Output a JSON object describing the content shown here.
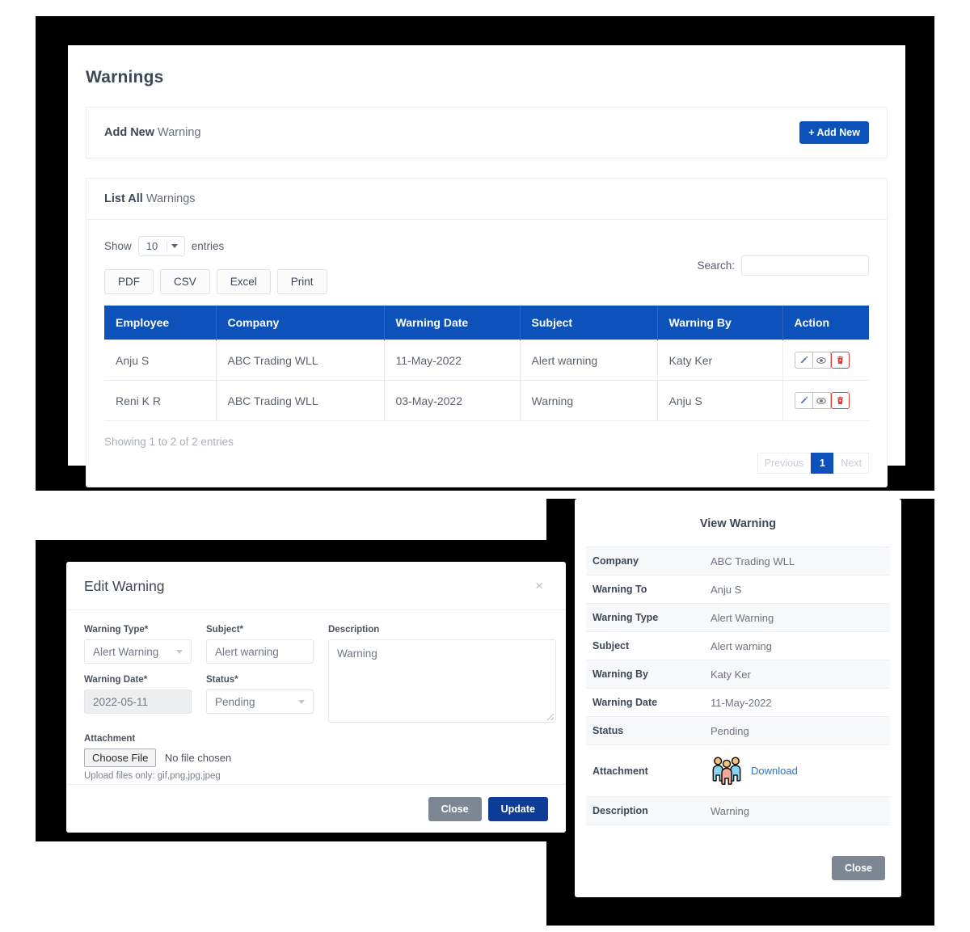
{
  "page": {
    "title": "Warnings",
    "add_card": {
      "label_strong": "Add New",
      "label_rest": " Warning",
      "button": "+ Add New"
    },
    "list_card": {
      "label_strong": "List All",
      "label_rest": " Warnings"
    }
  },
  "datatable": {
    "show_label": "Show",
    "length_value": "10",
    "entries_label": "entries",
    "export_buttons": [
      "PDF",
      "CSV",
      "Excel",
      "Print"
    ],
    "search_label": "Search:",
    "search_value": "",
    "search_placeholder": "",
    "columns": [
      "Employee",
      "Company",
      "Warning Date",
      "Subject",
      "Warning By",
      "Action"
    ],
    "rows": [
      {
        "employee": "Anju S",
        "company": "ABC Trading WLL",
        "warning_date": "11-May-2022",
        "subject": "Alert warning",
        "warning_by": "Katy Ker"
      },
      {
        "employee": "Reni K R",
        "company": "ABC Trading WLL",
        "warning_date": "03-May-2022",
        "subject": "Warning",
        "warning_by": "Anju S"
      }
    ],
    "info": "Showing 1 to 2 of 2 entries",
    "pagination": {
      "previous": "Previous",
      "page_1": "1",
      "next": "Next"
    }
  },
  "edit_modal": {
    "title": "Edit Warning",
    "close_icon": "×",
    "fields": {
      "warning_type_label": "Warning Type*",
      "warning_type_value": "Alert Warning",
      "subject_label": "Subject*",
      "subject_value": "Alert warning",
      "description_label": "Description",
      "description_value": "Warning",
      "warning_date_label": "Warning Date*",
      "warning_date_value": "2022-05-11",
      "status_label": "Status*",
      "status_value": "Pending",
      "attachment_label": "Attachment",
      "file_button": "Choose File",
      "file_name": "No file chosen",
      "upload_hint": "Upload files only: gif,png,jpg,jpeg"
    },
    "footer": {
      "close": "Close",
      "update": "Update"
    }
  },
  "view_panel": {
    "title": "View Warning",
    "rows": [
      {
        "key": "Company",
        "value": "ABC Trading WLL"
      },
      {
        "key": "Warning To",
        "value": "Anju S"
      },
      {
        "key": "Warning Type",
        "value": "Alert Warning"
      },
      {
        "key": "Subject",
        "value": "Alert warning"
      },
      {
        "key": "Warning By",
        "value": "Katy Ker"
      },
      {
        "key": "Warning Date",
        "value": "11-May-2022"
      },
      {
        "key": "Status",
        "value": "Pending"
      }
    ],
    "attachment": {
      "key": "Attachment",
      "download_label": "Download"
    },
    "description": {
      "key": "Description",
      "value": "Warning"
    },
    "close_button": "Close"
  },
  "colors": {
    "primary_blue": "#0d52ba",
    "dark_blue": "#0d3c96",
    "grey_button": "#7d8793",
    "danger_red": "#e23b3b",
    "link_blue": "#2a77d4",
    "backdrop": "#000000"
  }
}
